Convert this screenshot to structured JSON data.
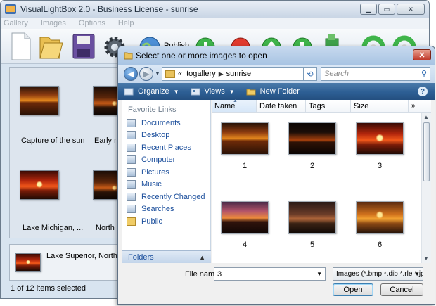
{
  "app": {
    "title": "VisualLightBox 2.0 - Business License - sunrise",
    "menu": [
      "Gallery",
      "Images",
      "Options",
      "Help"
    ],
    "toolbar": {
      "publish_label": "Publish"
    },
    "gallery": [
      {
        "caption": "Capture of the sun",
        "photo": "s1"
      },
      {
        "caption": "Early mo",
        "photo": "s2"
      },
      {
        "caption": "Lake Michigan, ...",
        "photo": "s3"
      },
      {
        "caption": "North P",
        "photo": "s2"
      }
    ],
    "selected_info": "Lake Superior, Northern On",
    "status": "1 of 12 items selected"
  },
  "dialog": {
    "title": "Select one or more images to open",
    "address": {
      "root": "«",
      "path": [
        "togallery",
        "sunrise"
      ]
    },
    "search_placeholder": "Search",
    "commands": {
      "organize": "Organize",
      "views": "Views",
      "new_folder": "New Folder"
    },
    "favorite_links_header": "Favorite Links",
    "favorite_links": [
      "Documents",
      "Desktop",
      "Recent Places",
      "Computer",
      "Pictures",
      "Music",
      "Recently Changed",
      "Searches",
      "Public"
    ],
    "folders_label": "Folders",
    "columns": [
      "Name",
      "Date taken",
      "Tags",
      "Size"
    ],
    "more_columns": "»",
    "files": [
      {
        "name": "1",
        "photo": "s1"
      },
      {
        "name": "2",
        "photo": "s4"
      },
      {
        "name": "3",
        "photo": "s3"
      },
      {
        "name": "4",
        "photo": "s5"
      },
      {
        "name": "5",
        "photo": "s8"
      },
      {
        "name": "6",
        "photo": "s6"
      }
    ],
    "file_name_label": "File name:",
    "file_name_value": "3",
    "file_type": "Images (*.bmp *.dib *.rle *.jpg",
    "open_label": "Open",
    "cancel_label": "Cancel"
  },
  "colors": {
    "accent": "#2d5f94",
    "link": "#1c4f9c",
    "title_bar": "#c7d9ee"
  }
}
